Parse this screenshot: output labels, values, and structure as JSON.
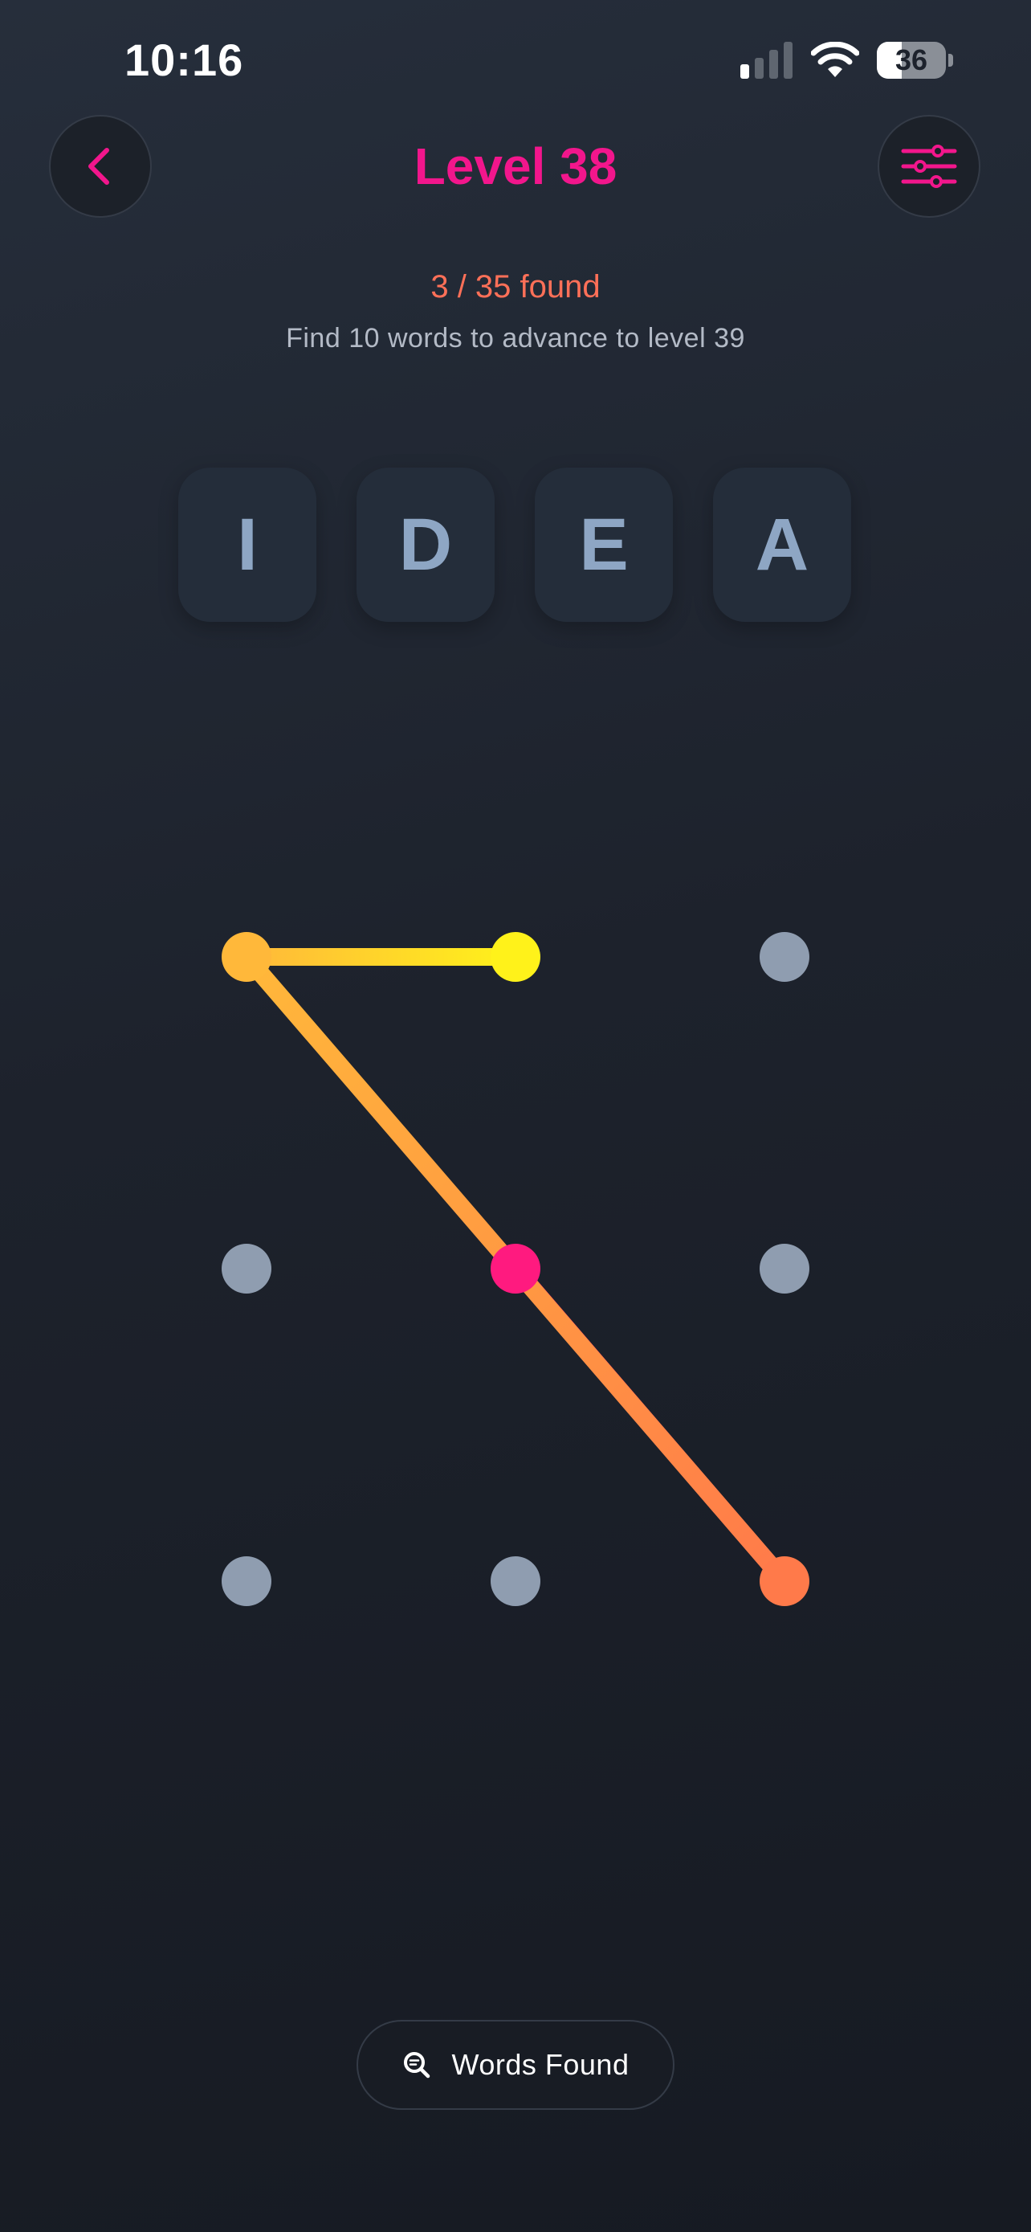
{
  "status_bar": {
    "time": "10:16",
    "battery_level": "36",
    "icons": [
      "signal-icon",
      "wifi-icon",
      "battery-icon"
    ]
  },
  "header": {
    "title": "Level 38",
    "back_icon": "chevron-left-icon",
    "settings_icon": "sliders-icon"
  },
  "progress": {
    "found_text": "3 / 35 found",
    "hint": "Find 10 words to advance to level 39"
  },
  "letters": [
    "I",
    "D",
    "E",
    "A"
  ],
  "pattern": {
    "path_sequence": [
      4,
      8,
      0,
      1
    ],
    "inactive_dot_color": "#8f9db0",
    "gradient_colors": [
      "#ff1a7f",
      "#ff7a4a",
      "#ffb83a",
      "#fff21a"
    ]
  },
  "footer": {
    "words_found_label": "Words Found",
    "icon": "search-list-icon"
  },
  "colors": {
    "accent": "#f2168c",
    "progress": "#ff7058",
    "tile_text": "#8ea6c4"
  }
}
